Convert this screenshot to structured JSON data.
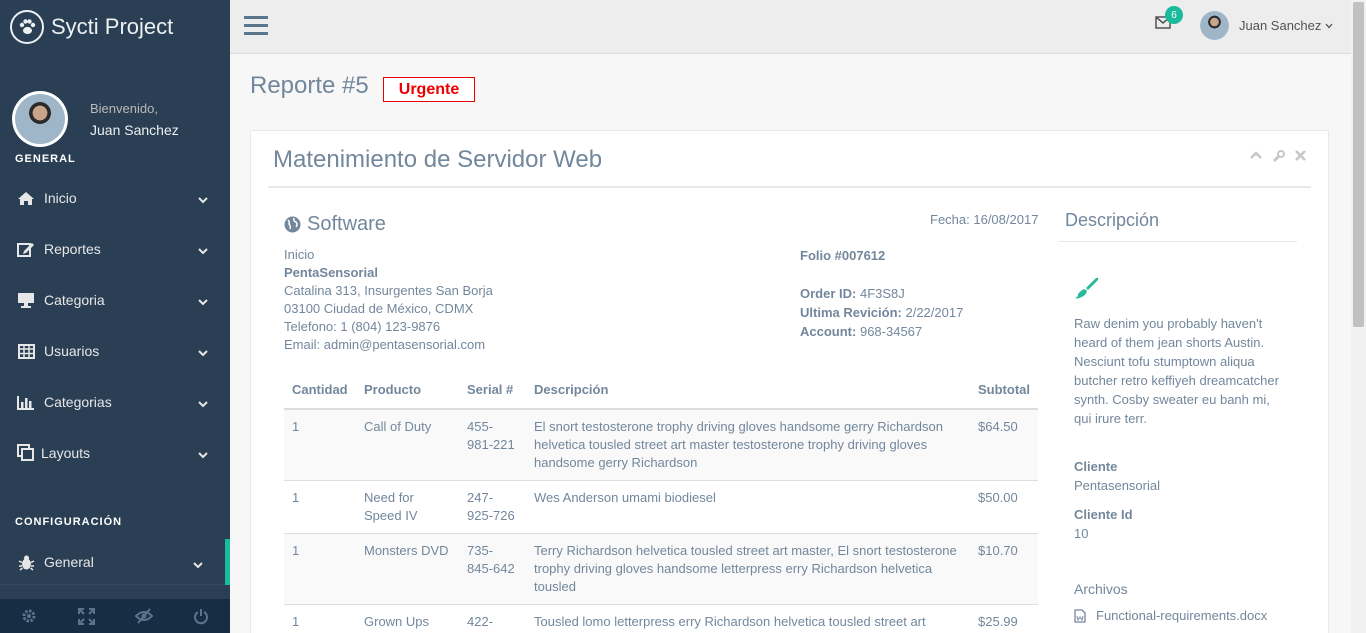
{
  "app": {
    "title": "Sycti Project"
  },
  "profile": {
    "welcome": "Bienvenido,",
    "name": "Juan Sanchez"
  },
  "sidebar": {
    "general_title": "GENERAL",
    "config_title": "CONFIGURACIÓN",
    "items": [
      {
        "label": "Inicio",
        "icon": "home-icon"
      },
      {
        "label": "Reportes",
        "icon": "edit-icon"
      },
      {
        "label": "Categoria",
        "icon": "desktop-icon"
      },
      {
        "label": "Usuarios",
        "icon": "table-icon"
      },
      {
        "label": "Categorias",
        "icon": "bar-chart-icon"
      },
      {
        "label": "Layouts",
        "icon": "clone-icon"
      }
    ],
    "config_items": [
      {
        "label": "General",
        "icon": "bug-icon"
      }
    ],
    "footer": [
      "settings-icon",
      "fullscreen-icon",
      "eye-slash-icon",
      "power-icon"
    ]
  },
  "topnav": {
    "mail_count": "6",
    "user": "Juan Sanchez"
  },
  "page": {
    "title": "Reporte #5",
    "priority": "Urgente"
  },
  "panel": {
    "title": "Matenimiento de Servidor Web",
    "section": "Software",
    "date": "Fecha: 16/08/2017",
    "address": {
      "line0": "Inicio",
      "company": "PentaSensorial",
      "line1": "Catalina 313, Insurgentes San Borja",
      "line2": "03100 Ciudad de México, CDMX",
      "phone": "Telefono: 1 (804) 123-9876",
      "email": "Email: admin@pentasensorial.com"
    },
    "folio": "Folio #007612",
    "order_label": "Order ID:",
    "order_val": "4F3S8J",
    "rev_label": "Ultima Revición:",
    "rev_val": "2/22/2017",
    "account_label": "Account:",
    "account_val": "968-34567",
    "table": {
      "headers": [
        "Cantidad",
        "Producto",
        "Serial #",
        "Descripción",
        "Subtotal"
      ],
      "rows": [
        [
          "1",
          "Call of Duty",
          "455-981-221",
          "El snort testosterone trophy driving gloves handsome gerry Richardson helvetica tousled street art master testosterone trophy driving gloves handsome gerry Richardson",
          "$64.50"
        ],
        [
          "1",
          "Need for Speed IV",
          "247-925-726",
          "Wes Anderson umami biodiesel",
          "$50.00"
        ],
        [
          "1",
          "Monsters DVD",
          "735-845-642",
          "Terry Richardson helvetica tousled street art master, El snort testosterone trophy driving gloves handsome letterpress erry Richardson helvetica tousled",
          "$10.70"
        ],
        [
          "1",
          "Grown Ups",
          "422-",
          "Tousled lomo letterpress erry Richardson helvetica tousled street art",
          "$25.99"
        ]
      ]
    },
    "desc": {
      "title": "Descripción",
      "text": "Raw denim you probably haven't heard of them jean shorts Austin. Nesciunt tofu stumptown aliqua butcher retro keffiyeh dreamcatcher synth. Cosby sweater eu banh mi, qui irure terr.",
      "client_label": "Cliente",
      "client_val": "Pentasensorial",
      "clientid_label": "Cliente Id",
      "clientid_val": "10",
      "files_title": "Archivos",
      "file": "Functional-requirements.docx"
    }
  },
  "colors": {
    "sidebar": "#2A3F54",
    "accent": "#1ABB9C",
    "urgent": "#EE0000"
  }
}
